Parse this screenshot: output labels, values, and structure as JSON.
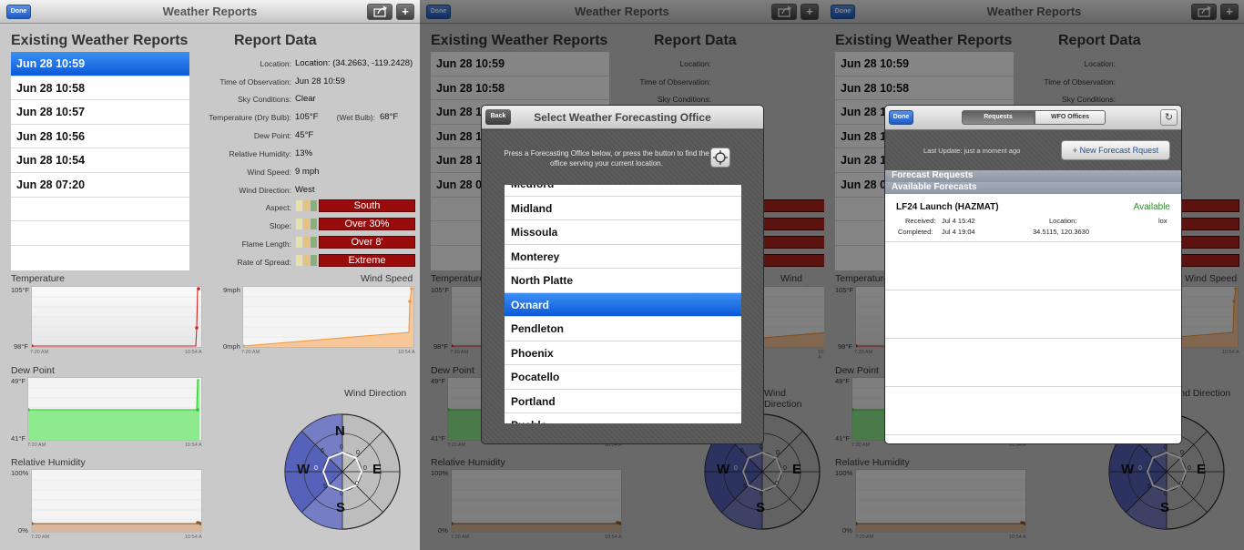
{
  "app": {
    "title": "Weather Reports",
    "done_label": "Done",
    "share_icon": "share-icon",
    "add_icon": "plus-icon"
  },
  "reports": {
    "heading": "Existing Weather Reports",
    "items": [
      "Jun 28 10:59",
      "Jun 28 10:58",
      "Jun 28 10:57",
      "Jun 28 10:56",
      "Jun 28 10:54",
      "Jun 28 07:20"
    ]
  },
  "report_data": {
    "heading": "Report Data",
    "location_label": "Location:",
    "location_value": "Location: (34.2663, -119.2428)",
    "time_label": "Time of Observation:",
    "time_value": "Jun 28 10:59",
    "sky_label": "Sky Conditions:",
    "sky_value": "Clear",
    "temp_label": "Temperature (Dry Bulb):",
    "temp_value": "105°F",
    "wetbulb_label": "(Wet Bulb):",
    "wetbulb_value": "68°F",
    "dew_label": "Dew Point:",
    "dew_value": "45°F",
    "rh_label": "Relative Humidity:",
    "rh_value": "13%",
    "ws_label": "Wind Speed:",
    "ws_value": "9 mph",
    "wd_label": "Wind Direction:",
    "wd_value": "West",
    "aspect_label": "Aspect:",
    "aspect_value": "South",
    "slope_label": "Slope:",
    "slope_value": "Over 30%",
    "flame_label": "Flame Length:",
    "flame_value": "Over 8'",
    "spread_label": "Rate of Spread:",
    "spread_value": "Extreme"
  },
  "charts": {
    "temperature": {
      "title": "Temperature",
      "ymax": "105°F",
      "ymin": "98°F",
      "x0": "7:20 AM",
      "x1": "10:54 A"
    },
    "wind_speed": {
      "title": "Wind Speed",
      "ymax": "9mph",
      "ymin": "0mph",
      "x0": "7:20 AM",
      "x1": "10:54 A"
    },
    "dew_point": {
      "title": "Dew Point",
      "ymax": "49°F",
      "ymin": "41°F",
      "x0": "7:20 AM",
      "x1": "10:54 A"
    },
    "humidity": {
      "title": "Relative Humidity",
      "ymax": "100%",
      "ymin": "0%",
      "x0": "7:20 AM",
      "x1": "10:54 A"
    },
    "wind_direction": {
      "title": "Wind Direction",
      "n": "N",
      "e": "E",
      "s": "S",
      "w": "W",
      "zero": "0",
      "six": "6",
      "five": "5"
    }
  },
  "colors": {
    "temperature": "#d42020",
    "wind_speed": "#f09a3e",
    "dew_point": "#2fc42f",
    "humidity": "#8b5a2b",
    "selection": "#0c5ad8",
    "rating_red": "#9a0c0c"
  },
  "select_office": {
    "back_label": "Back",
    "title": "Select Weather Forecasting Office",
    "hint": "Press a Forecasting Office below, or press the button to find the office serving your current location.",
    "locate_icon": "crosshair-icon",
    "offices": [
      "Medford",
      "Midland",
      "Missoula",
      "Monterey",
      "North Platte",
      "Oxnard",
      "Pendleton",
      "Phoenix",
      "Pocatello",
      "Portland",
      "Pueblo"
    ],
    "selected": "Oxnard"
  },
  "forecast": {
    "done_label": "Done",
    "tab_requests": "Requests",
    "tab_offices": "WFO Offices",
    "refresh_icon": "refresh-icon",
    "last_update": "Last Update: just a moment ago",
    "new_button": "New Forecast Rquest",
    "section_requests": "Forecast Requests",
    "section_available": "Available Forecasts",
    "item": {
      "title": "LF24 Launch (HAZMAT)",
      "status": "Available",
      "received_label": "Received:",
      "received_value": "Jul 4 15:42",
      "completed_label": "Completed:",
      "completed_value": "Jul 4 19:04",
      "location_label": "Location:",
      "location_value": "34.5115, 120.3630",
      "office_value": "lox"
    }
  }
}
